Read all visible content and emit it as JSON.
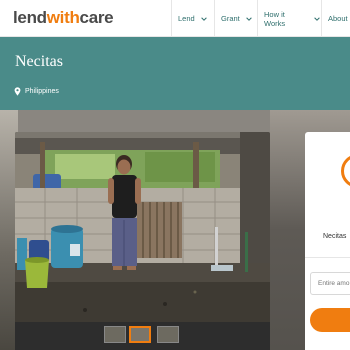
{
  "nav": {
    "logo_part1": "lend",
    "logo_part2": "with",
    "logo_part3": "care",
    "items": [
      {
        "label": "Lend"
      },
      {
        "label": "Grant"
      },
      {
        "label": "How it Works"
      },
      {
        "label": "About"
      }
    ]
  },
  "profile": {
    "name": "Necitas",
    "location": "Philippines"
  },
  "lend_card": {
    "name": "Necitas",
    "amount_placeholder": "Entire amo"
  },
  "colors": {
    "brand_teal": "#4a8b89",
    "accent_orange": "#f07d10",
    "nav_text": "#2f6f6d"
  },
  "icons": [
    "chevron-down-icon",
    "map-pin-icon"
  ]
}
